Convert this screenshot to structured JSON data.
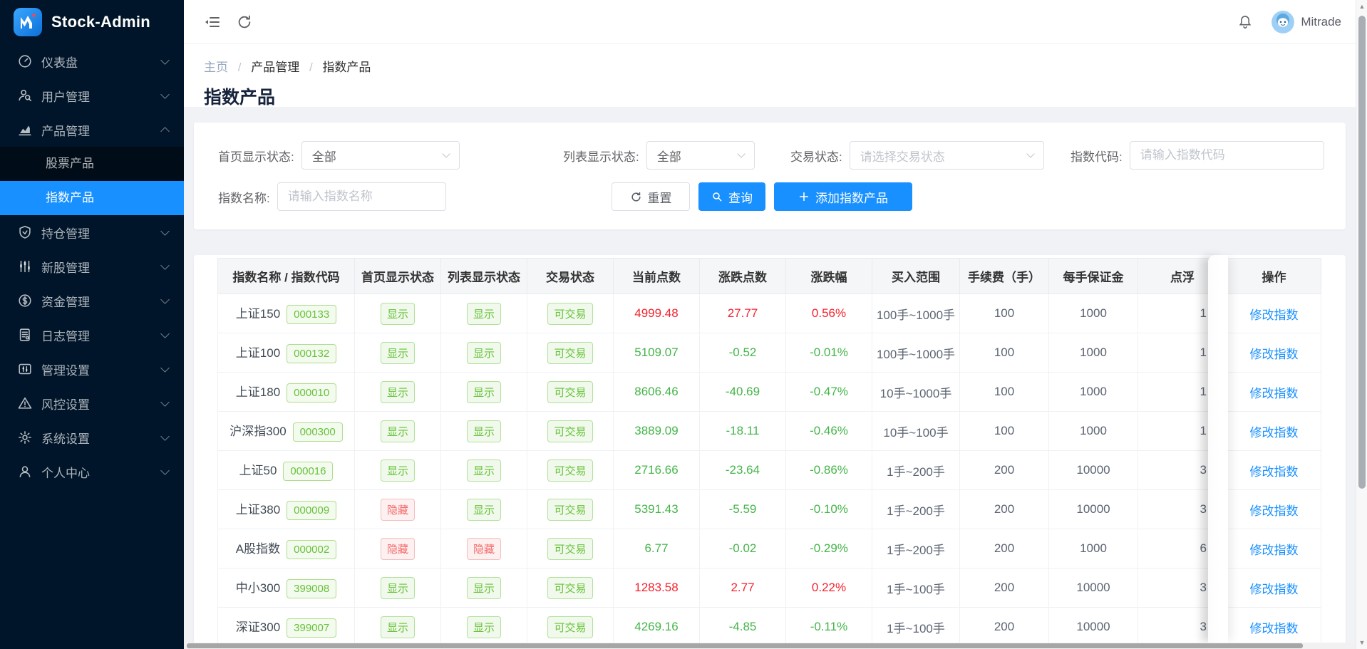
{
  "app": {
    "title": "Stock-Admin",
    "user": "Mitrade"
  },
  "colors": {
    "sidebar_bg": "#001529",
    "submenu_bg": "#000c17",
    "accent_blue": "#1890ff",
    "up_red": "#f5222d",
    "down_green": "#44b549",
    "badge_green": "#67c23a",
    "badge_red": "#f56c6c",
    "content_bg": "#f0f2f5"
  },
  "sidebar": {
    "items": [
      {
        "id": "dashboard",
        "icon": "dashboard-icon",
        "label": "仪表盘",
        "expanded": false
      },
      {
        "id": "users",
        "icon": "users-icon",
        "label": "用户管理",
        "expanded": false
      },
      {
        "id": "products",
        "icon": "products-icon",
        "label": "产品管理",
        "expanded": true,
        "children": [
          {
            "label": "股票产品",
            "active": false
          },
          {
            "label": "指数产品",
            "active": true
          }
        ]
      },
      {
        "id": "positions",
        "icon": "positions-icon",
        "label": "持仓管理",
        "expanded": false
      },
      {
        "id": "newstock",
        "icon": "newstock-icon",
        "label": "新股管理",
        "expanded": false
      },
      {
        "id": "funds",
        "icon": "funds-icon",
        "label": "资金管理",
        "expanded": false
      },
      {
        "id": "logs",
        "icon": "logs-icon",
        "label": "日志管理",
        "expanded": false
      },
      {
        "id": "admin-settings",
        "icon": "admin-settings-icon",
        "label": "管理设置",
        "expanded": false
      },
      {
        "id": "risk",
        "icon": "risk-icon",
        "label": "风控设置",
        "expanded": false
      },
      {
        "id": "system",
        "icon": "system-icon",
        "label": "系统设置",
        "expanded": false
      },
      {
        "id": "profile",
        "icon": "profile-icon",
        "label": "个人中心",
        "expanded": false
      }
    ]
  },
  "breadcrumb": [
    "主页",
    "产品管理",
    "指数产品"
  ],
  "page_title": "指数产品",
  "filters": {
    "home_status_label": "首页显示状态:",
    "home_status_value": "全部",
    "list_status_label": "列表显示状态:",
    "list_status_value": "全部",
    "trade_status_label": "交易状态:",
    "trade_status_placeholder": "请选择交易状态",
    "index_code_label": "指数代码:",
    "index_code_placeholder": "请输入指数代码",
    "index_name_label": "指数名称:",
    "index_name_placeholder": "请输入指数名称",
    "reset_label": "重置",
    "search_label": "查询",
    "add_label": "添加指数产品"
  },
  "table": {
    "columns": [
      "指数名称 / 指数代码",
      "首页显示状态",
      "列表显示状态",
      "交易状态",
      "当前点数",
      "涨跌点数",
      "涨跌幅",
      "买入范围",
      "手续费（手）",
      "每手保证金",
      "点浮",
      "操作"
    ],
    "action_label": "修改指数",
    "rows": [
      {
        "name": "上证150",
        "code": "000133",
        "home": "显示",
        "list": "显示",
        "trade": "可交易",
        "price": "4999.48",
        "change": "27.77",
        "pct": "0.56%",
        "trend": "up",
        "range": "100手~1000手",
        "fee": "100",
        "margin": "1000",
        "partial": "1"
      },
      {
        "name": "上证100",
        "code": "000132",
        "home": "显示",
        "list": "显示",
        "trade": "可交易",
        "price": "5109.07",
        "change": "-0.52",
        "pct": "-0.01%",
        "trend": "down",
        "range": "100手~1000手",
        "fee": "100",
        "margin": "1000",
        "partial": "1"
      },
      {
        "name": "上证180",
        "code": "000010",
        "home": "显示",
        "list": "显示",
        "trade": "可交易",
        "price": "8606.46",
        "change": "-40.69",
        "pct": "-0.47%",
        "trend": "down",
        "range": "10手~1000手",
        "fee": "100",
        "margin": "1000",
        "partial": "1"
      },
      {
        "name": "沪深指300",
        "code": "000300",
        "home": "显示",
        "list": "显示",
        "trade": "可交易",
        "price": "3889.09",
        "change": "-18.11",
        "pct": "-0.46%",
        "trend": "down",
        "range": "10手~100手",
        "fee": "100",
        "margin": "1000",
        "partial": "1"
      },
      {
        "name": "上证50",
        "code": "000016",
        "home": "显示",
        "list": "显示",
        "trade": "可交易",
        "price": "2716.66",
        "change": "-23.64",
        "pct": "-0.86%",
        "trend": "down",
        "range": "1手~200手",
        "fee": "200",
        "margin": "10000",
        "partial": "3"
      },
      {
        "name": "上证380",
        "code": "000009",
        "home": "隐藏",
        "list": "显示",
        "trade": "可交易",
        "price": "5391.43",
        "change": "-5.59",
        "pct": "-0.10%",
        "trend": "down",
        "range": "1手~200手",
        "fee": "200",
        "margin": "10000",
        "partial": "3"
      },
      {
        "name": "A股指数",
        "code": "000002",
        "home": "隐藏",
        "list": "隐藏",
        "trade": "可交易",
        "price": "6.77",
        "change": "-0.02",
        "pct": "-0.29%",
        "trend": "down",
        "range": "1手~200手",
        "fee": "200",
        "margin": "1000",
        "partial": "6"
      },
      {
        "name": "中小300",
        "code": "399008",
        "home": "显示",
        "list": "显示",
        "trade": "可交易",
        "price": "1283.58",
        "change": "2.77",
        "pct": "0.22%",
        "trend": "up",
        "range": "1手~100手",
        "fee": "200",
        "margin": "10000",
        "partial": "3"
      },
      {
        "name": "深证300",
        "code": "399007",
        "home": "显示",
        "list": "显示",
        "trade": "可交易",
        "price": "4269.16",
        "change": "-4.85",
        "pct": "-0.11%",
        "trend": "down",
        "range": "1手~100手",
        "fee": "200",
        "margin": "10000",
        "partial": "3"
      }
    ]
  }
}
